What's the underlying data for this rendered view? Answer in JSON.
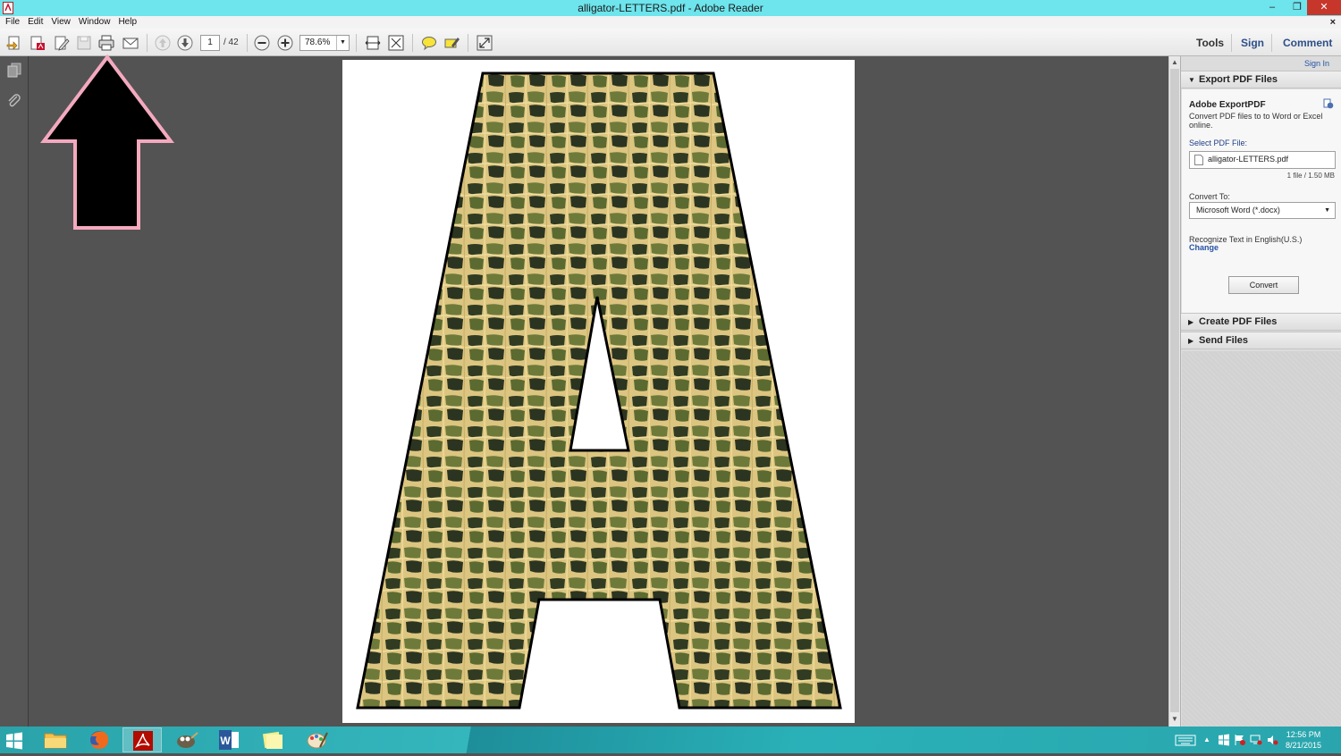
{
  "window": {
    "title": "alligator-LETTERS.pdf - Adobe Reader",
    "minimize": "–",
    "restore": "❐",
    "close": "✕"
  },
  "menu": {
    "items": [
      "File",
      "Edit",
      "View",
      "Window",
      "Help"
    ],
    "doc_close": "×"
  },
  "toolbar": {
    "page_current": "1",
    "page_total": "/ 42",
    "zoom": "78.6%",
    "tools_label": "Tools",
    "sign_label": "Sign",
    "comment_label": "Comment"
  },
  "right_pane": {
    "sign_in": "Sign In",
    "export_header": "Export PDF Files",
    "export_title": "Adobe ExportPDF",
    "export_desc": "Convert PDF files to to Word or Excel online.",
    "select_label": "Select PDF File:",
    "file_name": "alligator-LETTERS.pdf",
    "file_info": "1 file / 1.50 MB",
    "convert_to_label": "Convert To:",
    "convert_to_value": "Microsoft Word (*.docx)",
    "recognize_text": "Recognize Text in English(U.S.)",
    "change_link": "Change",
    "convert_button": "Convert",
    "create_header": "Create PDF Files",
    "send_header": "Send Files"
  },
  "taskbar": {
    "time": "12:56 PM",
    "date": "8/21/2015"
  },
  "colors": {
    "titlebar": "#6ee4ec",
    "arrow_fill": "#000000",
    "arrow_outline": "#f4a9bf",
    "letter_fill": "#d8c07a",
    "scale_dark": "#2f3a20"
  }
}
